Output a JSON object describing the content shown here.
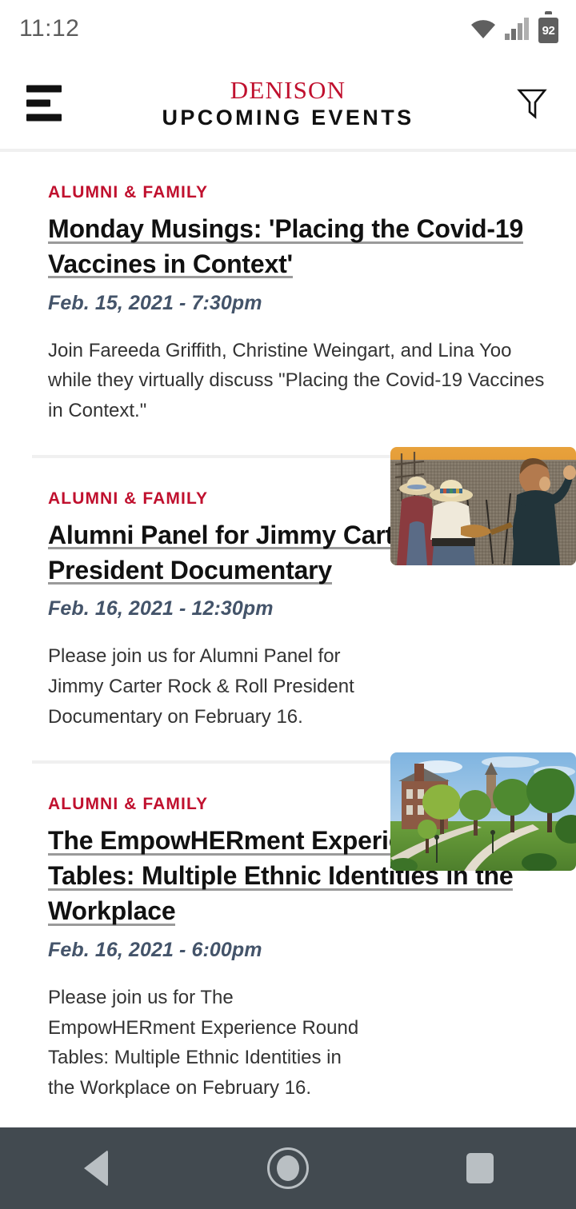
{
  "status_bar": {
    "time": "11:12",
    "wifi_icon": "wifi-icon",
    "signal_icon": "cellular-signal-icon",
    "battery_icon": "battery-icon",
    "battery_level": "92"
  },
  "header": {
    "menu_icon": "hamburger-menu-icon",
    "brand": "DENISON",
    "title": "UPCOMING EVENTS",
    "filter_icon": "filter-funnel-icon",
    "brand_color": "#c0102e"
  },
  "events": [
    {
      "category": "ALUMNI & FAMILY",
      "title": "Monday Musings: 'Placing the Covid-19 Vaccines in Context'",
      "date": "Feb. 15, 2021 - 7:30pm",
      "description": "Join Fareeda Griffith, Christine Weingart, and Lina Yoo while they virtually discuss \"Placing the Covid-19 Vaccines in Context.\"",
      "thumbnail": null
    },
    {
      "category": "ALUMNI & FAMILY",
      "title": "Alumni Panel for Jimmy Carter Rock & Roll President Documentary",
      "date": "Feb. 16, 2021 - 12:30pm",
      "description": "Please join us for Alumni Panel for Jimmy Carter Rock & Roll President Documentary on February 16.",
      "thumbnail": "concert-crowd-photo"
    },
    {
      "category": "ALUMNI & FAMILY",
      "title": "The EmpowHERment Experience Round Tables: Multiple Ethnic Identities in the Workplace",
      "date": "Feb. 16, 2021 - 6:00pm",
      "description": "Please join us for The EmpowHERment Experience Round Tables: Multiple Ethnic Identities in the Workplace on February 16.",
      "thumbnail": "campus-quad-photo"
    }
  ],
  "nav_bar": {
    "back_icon": "back-triangle-icon",
    "home_icon": "home-circle-icon",
    "recents_icon": "recents-square-icon"
  }
}
